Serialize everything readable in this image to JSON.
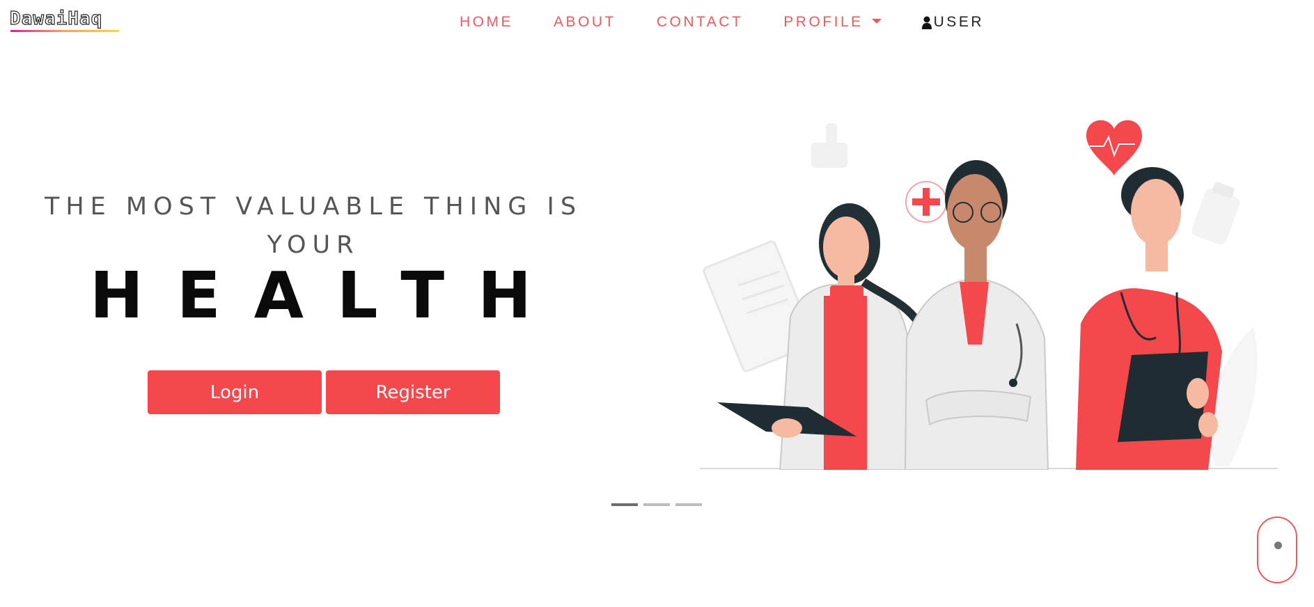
{
  "brand": {
    "name": "DawaiHaq"
  },
  "nav": {
    "items": [
      {
        "label": "HOME"
      },
      {
        "label": "ABOUT"
      },
      {
        "label": "CONTACT"
      },
      {
        "label": "PROFILE"
      }
    ],
    "user_label": "USER"
  },
  "hero": {
    "tagline": "THE MOST VALUABLE THING IS YOUR",
    "headline": "HEALTH",
    "login_label": "Login",
    "register_label": "Register"
  },
  "carousel": {
    "slide_count": 3,
    "active_index": 0
  },
  "colors": {
    "accent": "#f5484d",
    "nav_text": "#f0585c",
    "dark": "#1f2d33"
  },
  "icons": [
    "user-icon",
    "caret-down-icon",
    "scroll-mouse-icon"
  ]
}
